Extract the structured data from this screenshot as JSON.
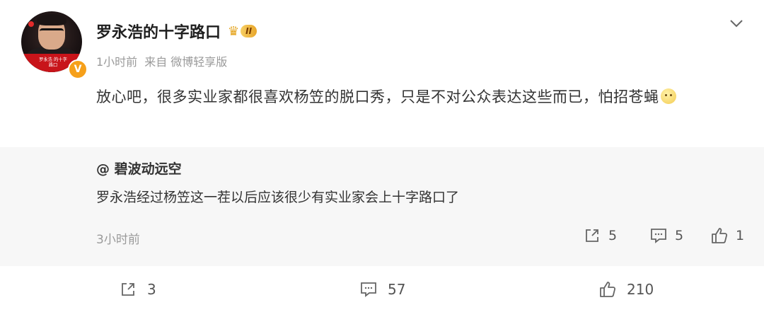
{
  "post": {
    "author": "罗永浩的十字路口",
    "level_badge": "II",
    "time": "1小时前",
    "source": "来自 微博轻享版",
    "body": "放心吧，很多实业家都很喜欢杨笠的脱口秀，只是不对公众表达这些而已，怕招苍蝇",
    "avatar_caption": "罗永浩 的十字路口",
    "verify_mark": "V"
  },
  "quote": {
    "author": "@ 碧波动远空",
    "text": "罗永浩经过杨笠这一茬以后应该很少有实业家会上十字路口了",
    "time": "3小时前",
    "repost_count": "5",
    "comment_count": "5",
    "like_count": "1"
  },
  "footer": {
    "repost_count": "3",
    "comment_count": "57",
    "like_count": "210"
  },
  "colors": {
    "accent_badge": "#f6a01a",
    "quote_bg": "#f7f7f7",
    "meta_text": "#9a9a9a"
  },
  "icons": {
    "menu": "chevron-down-icon",
    "repost": "repost-icon",
    "comment": "comment-icon",
    "like": "thumbs-up-icon"
  }
}
